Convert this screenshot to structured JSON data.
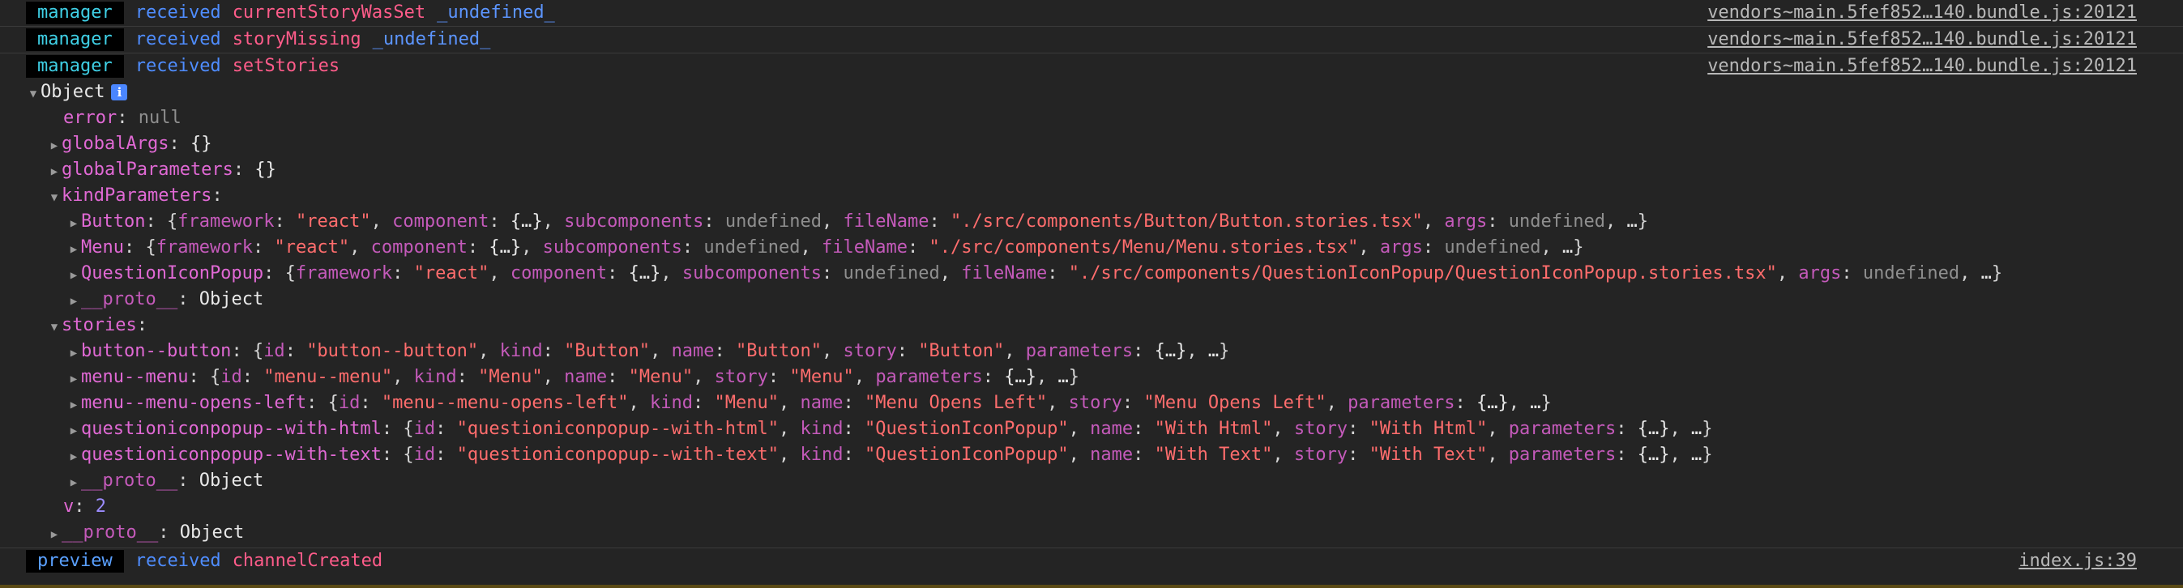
{
  "messages_top": [
    {
      "source": "manager",
      "verb": "received",
      "event": "currentStoryWasSet",
      "arg": "_undefined_",
      "location": "vendors~main.5fef852…140.bundle.js:20121"
    },
    {
      "source": "manager",
      "verb": "received",
      "event": "storyMissing",
      "arg": "_undefined_",
      "location": "vendors~main.5fef852…140.bundle.js:20121"
    },
    {
      "source": "manager",
      "verb": "received",
      "event": "setStories",
      "arg": "",
      "location": "vendors~main.5fef852…140.bundle.js:20121"
    }
  ],
  "object_root": {
    "label": "Object",
    "info": "i"
  },
  "error": {
    "key": "error",
    "value": "null"
  },
  "globalArgs": {
    "key": "globalArgs",
    "value": "{}"
  },
  "globalParameters": {
    "key": "globalParameters",
    "value": "{}"
  },
  "kindParameters": {
    "key": "kindParameters",
    "items": [
      {
        "name": "Button",
        "framework": "\"react\"",
        "fileName": "\"./src/components/Button/Button.stories.tsx\""
      },
      {
        "name": "Menu",
        "framework": "\"react\"",
        "fileName": "\"./src/components/Menu/Menu.stories.tsx\""
      },
      {
        "name": "QuestionIconPopup",
        "framework": "\"react\"",
        "fileName": "\"./src/components/QuestionIconPopup/QuestionIconPopup.stories.tsx\""
      }
    ],
    "proto": "__proto__",
    "proto_value": "Object"
  },
  "stories": {
    "key": "stories",
    "items": [
      {
        "key": "button--button",
        "id": "\"button--button\"",
        "kind": "\"Button\"",
        "name": "\"Button\"",
        "story": "\"Button\""
      },
      {
        "key": "menu--menu",
        "id": "\"menu--menu\"",
        "kind": "\"Menu\"",
        "name": "\"Menu\"",
        "story": "\"Menu\""
      },
      {
        "key": "menu--menu-opens-left",
        "id": "\"menu--menu-opens-left\"",
        "kind": "\"Menu\"",
        "name": "\"Menu Opens Left\"",
        "story": "\"Menu Opens Left\""
      },
      {
        "key": "questioniconpopup--with-html",
        "id": "\"questioniconpopup--with-html\"",
        "kind": "\"QuestionIconPopup\"",
        "name": "\"With Html\"",
        "story": "\"With Html\""
      },
      {
        "key": "questioniconpopup--with-text",
        "id": "\"questioniconpopup--with-text\"",
        "kind": "\"QuestionIconPopup\"",
        "name": "\"With Text\"",
        "story": "\"With Text\""
      }
    ],
    "proto": "__proto__",
    "proto_value": "Object"
  },
  "v": {
    "key": "v",
    "value": "2"
  },
  "root_proto": {
    "key": "__proto__",
    "value": "Object"
  },
  "message_bottom": {
    "source": "preview",
    "verb": "received",
    "event": "channelCreated",
    "location": "index.js:39"
  },
  "tokens": {
    "framework_key": "framework",
    "component_key": "component",
    "component_val": "{…}",
    "subcomponents_key": "subcomponents",
    "undefined": "undefined",
    "fileName_key": "fileName",
    "args_key": "args",
    "ellipsis": "…",
    "id_key": "id",
    "kind_key": "kind",
    "name_key": "name",
    "story_key": "story",
    "parameters_key": "parameters",
    "parameters_val": "{…}"
  }
}
